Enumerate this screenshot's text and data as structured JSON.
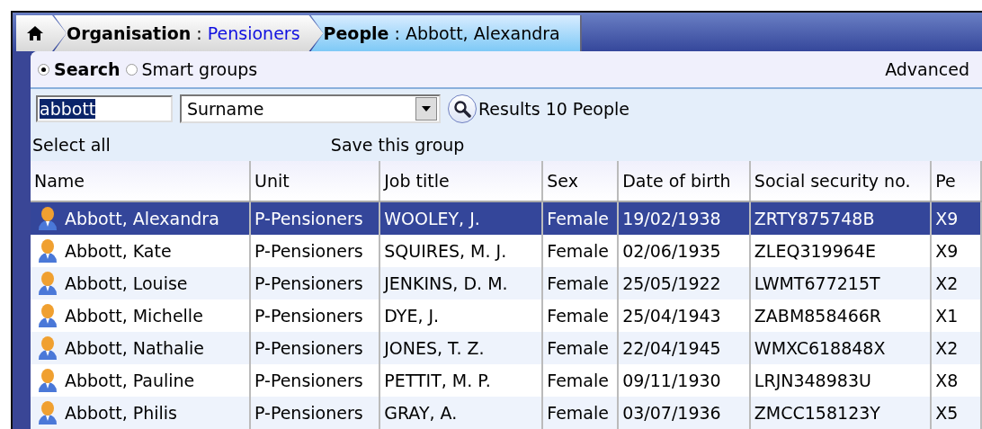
{
  "breadcrumb": [
    {
      "kind": "home"
    },
    {
      "kind": "crumb",
      "label": "Organisation",
      "separator": ":",
      "value": "Pensioners",
      "selected": false
    },
    {
      "kind": "crumb",
      "label": "People",
      "separator": ":",
      "value": "Abbott, Alexandra",
      "selected": true
    }
  ],
  "mode_options": [
    {
      "label": "Search",
      "selected": true
    },
    {
      "label": "Smart groups",
      "selected": false
    }
  ],
  "advanced_link": "Advanced",
  "search": {
    "value": "abbott",
    "text_selected": true
  },
  "field_dropdown": {
    "value": "Surname"
  },
  "results": "Results 10 People",
  "select_all": "Select all",
  "save_group": "Save this group",
  "table": {
    "columns": [
      "Name",
      "Unit",
      "Job title",
      "Sex",
      "Date of birth",
      "Social security no.",
      "Pe"
    ],
    "rows": [
      {
        "selected": true,
        "cells": [
          "Abbott, Alexandra",
          "P-Pensioners",
          "WOOLEY, J.",
          "Female",
          "19/02/1938",
          "ZRTY875748B",
          "X9"
        ]
      },
      {
        "selected": false,
        "cells": [
          "Abbott, Kate",
          "P-Pensioners",
          "SQUIRES, M. J.",
          "Female",
          "02/06/1935",
          "ZLEQ319964E",
          "X9"
        ]
      },
      {
        "selected": false,
        "cells": [
          "Abbott, Louise",
          "P-Pensioners",
          "JENKINS, D. M.",
          "Female",
          "25/05/1922",
          "LWMT677215T",
          "X2"
        ]
      },
      {
        "selected": false,
        "cells": [
          "Abbott, Michelle",
          "P-Pensioners",
          "DYE, J.",
          "Female",
          "25/04/1943",
          "ZABM858466R",
          "X1"
        ]
      },
      {
        "selected": false,
        "cells": [
          "Abbott, Nathalie",
          "P-Pensioners",
          "JONES, T. Z.",
          "Female",
          "22/04/1945",
          "WMXC618848X",
          "X2"
        ]
      },
      {
        "selected": false,
        "cells": [
          "Abbott, Pauline",
          "P-Pensioners",
          "PETTIT, M. P.",
          "Female",
          "09/11/1930",
          "LRJN348983U",
          "X8"
        ]
      },
      {
        "selected": false,
        "cells": [
          "Abbott, Philis",
          "P-Pensioners",
          "GRAY, A.",
          "Female",
          "03/07/1936",
          "ZMCC158123Y",
          "X5"
        ]
      }
    ]
  }
}
